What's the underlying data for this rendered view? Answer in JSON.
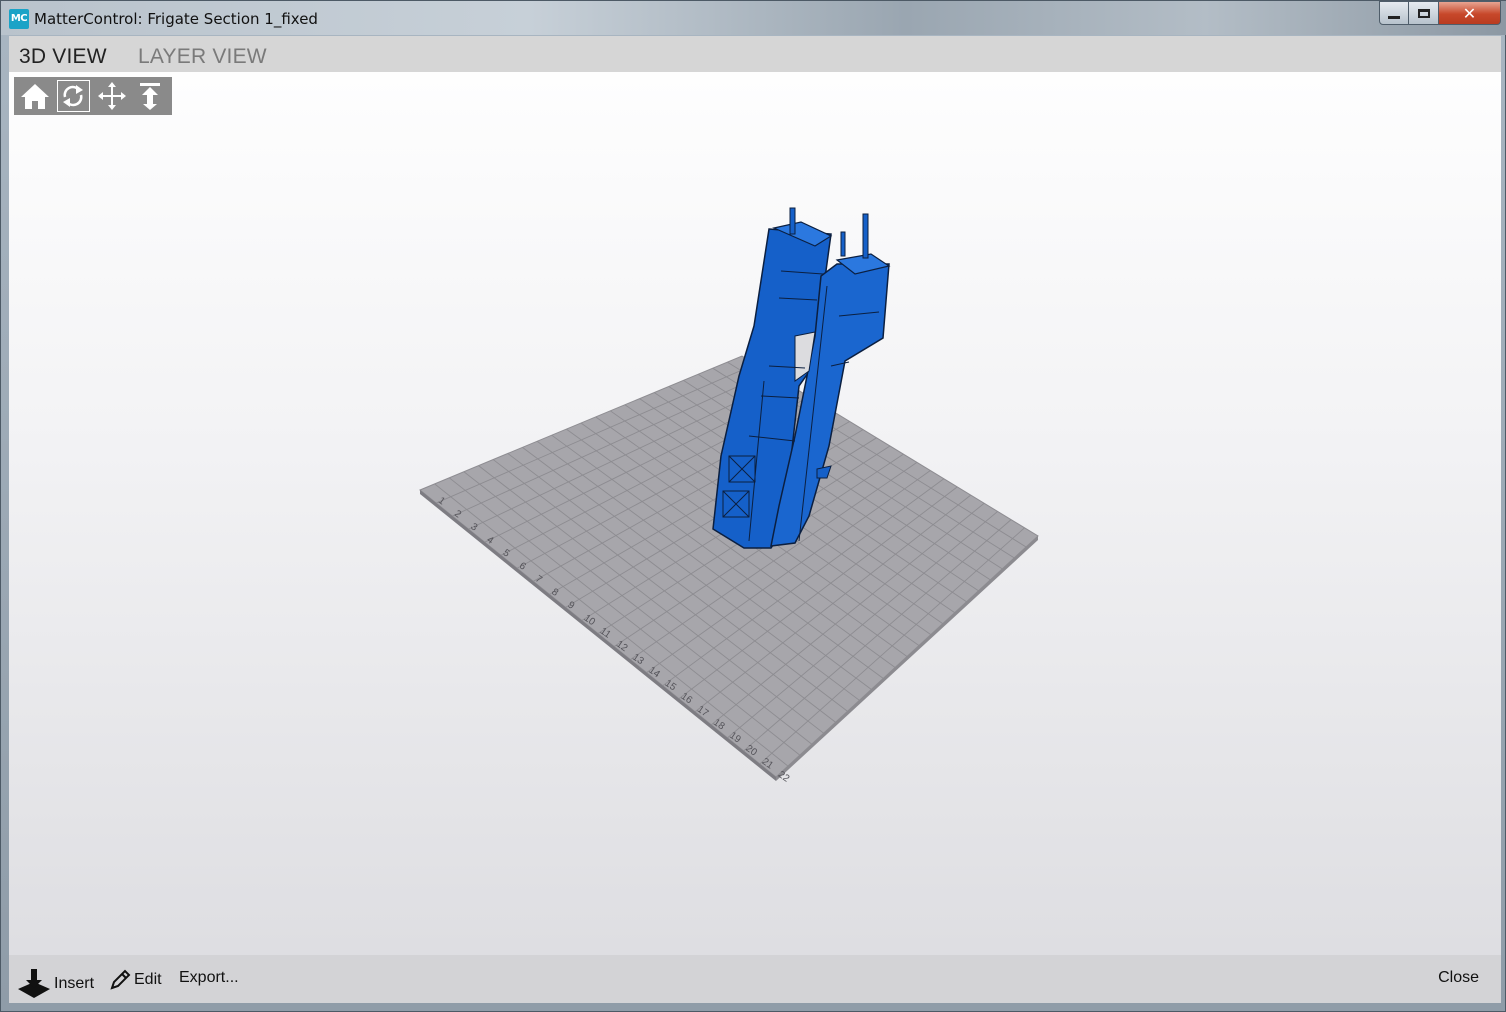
{
  "window": {
    "app_icon_text": "MC",
    "title": "MatterControl: Frigate Section 1_fixed",
    "controls": {
      "minimize": "minimize",
      "maximize": "maximize",
      "close_glyph": "✕"
    }
  },
  "tabs": [
    {
      "label": "3D VIEW",
      "active": true
    },
    {
      "label": "LAYER VIEW",
      "active": false
    }
  ],
  "view_tools": [
    {
      "icon": "home-icon",
      "selected": false
    },
    {
      "icon": "rotate-icon",
      "selected": true
    },
    {
      "icon": "move-icon",
      "selected": false
    },
    {
      "icon": "zoom-icon",
      "selected": false
    }
  ],
  "bed": {
    "grid_labels": [
      "1",
      "2",
      "3",
      "4",
      "5",
      "6",
      "7",
      "8",
      "9",
      "10",
      "11",
      "12",
      "13",
      "14",
      "15",
      "16",
      "17",
      "18",
      "19",
      "20",
      "21",
      "22"
    ],
    "color": "#a7a6ab",
    "model_color": "#1560c9"
  },
  "bottom_bar": {
    "insert_label": "Insert",
    "edit_label": "Edit",
    "export_label": "Export...",
    "close_label": "Close"
  }
}
